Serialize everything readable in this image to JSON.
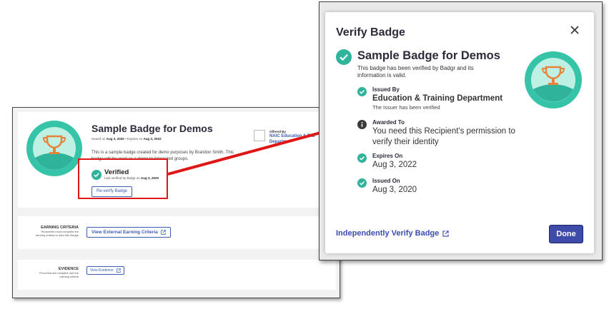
{
  "back": {
    "badge_title": "Sample Badge for Demos",
    "issued_prefix": "Issued on",
    "issued_date": "Aug 3, 2020",
    "sep": "•",
    "expires_prefix": "Expires on",
    "expires_date": "Aug 3, 2022",
    "description": "This is a sample badge created for demo purposes by Brandon Smith. This badge will be used as a demo to interested groups.",
    "verified_label": "Verified",
    "verified_sub_prefix": "Last verified by Badgr on",
    "verified_sub_date": "Aug 3, 2020",
    "reverify_label": "Re-verify Badge",
    "offered_label": "Offered By",
    "offered_name_1": "NAIC Education & Trai",
    "offered_name_2": "Departme",
    "earning": {
      "heading": "EARNING CRITERIA",
      "desc_1": "Recipients must complete the",
      "desc_2": "earning criteria to earn this Badge",
      "button": "View External Earning Criteria"
    },
    "evidence": {
      "heading": "EVIDENCE",
      "desc_1": "Proof that the recipient met the",
      "desc_2": "earning criteria",
      "button": "View Evidence"
    }
  },
  "modal": {
    "title": "Verify Badge",
    "badge_name": "Sample Badge for Demos",
    "verified_msg": "This badge has been verified by Badgr and its information is valid.",
    "items": [
      {
        "label": "Issued By",
        "value": "Education & Training Department",
        "sub": "The Issuer has been verified",
        "status": "ok"
      },
      {
        "label": "Awarded To",
        "value": "You need this Recipient's permission to verify their identity",
        "status": "info"
      },
      {
        "label": "Expires On",
        "value": "Aug 3, 2022",
        "status": "ok"
      },
      {
        "label": "Issued On",
        "value": "Aug 3, 2020",
        "status": "ok"
      }
    ],
    "independent_link": "Independently Verify Badge",
    "done": "Done"
  },
  "colors": {
    "teal": "#2fb39a",
    "navy_button": "#3f4ba8",
    "link_blue": "#3b4bb0",
    "highlight_red": "#e01515"
  }
}
